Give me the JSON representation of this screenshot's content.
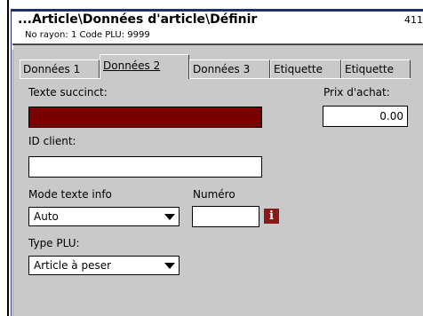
{
  "header": {
    "title": "...Article\\Données d'article\\Définir",
    "number": "411",
    "subtitle": "No rayon: 1  Code PLU: 9999"
  },
  "tabs": [
    {
      "label": "Données 1",
      "active": false
    },
    {
      "label": "Données 2",
      "active": true
    },
    {
      "label": "Données 3",
      "active": false
    },
    {
      "label": "Etiquette",
      "active": false
    },
    {
      "label": "Etiquette",
      "active": false
    }
  ],
  "form": {
    "short_text_label": "Texte succinct:",
    "short_text_value": "",
    "purchase_price_label": "Prix d'achat:",
    "purchase_price_value": "0.00",
    "client_id_label": "ID client:",
    "client_id_value": "",
    "info_mode_label": "Mode texte info",
    "info_mode_value": "Auto",
    "number_label": "Numéro",
    "number_value": "",
    "plu_type_label": "Type PLU:",
    "plu_type_value": "Article à peser"
  },
  "colors": {
    "panel": "#c9c9c9",
    "highlight_field": "#7a0000",
    "info_icon": "#8a1a1a"
  },
  "icons": {
    "info": "info-icon",
    "dropdown": "chevron-down-icon"
  }
}
